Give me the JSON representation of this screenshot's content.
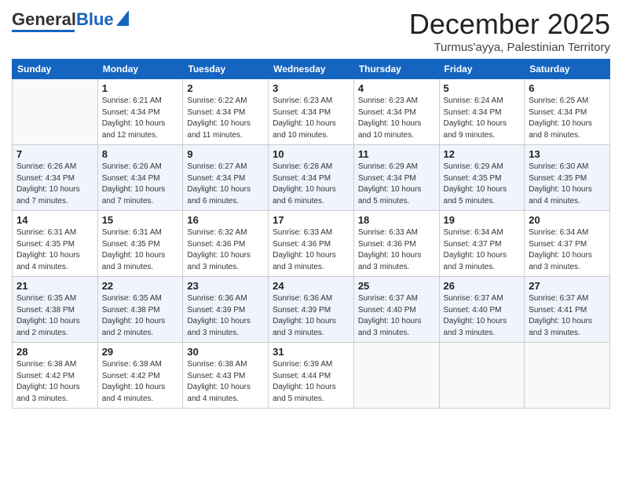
{
  "logo": {
    "general": "General",
    "blue": "Blue"
  },
  "header": {
    "month": "December 2025",
    "location": "Turmus'ayya, Palestinian Territory"
  },
  "weekdays": [
    "Sunday",
    "Monday",
    "Tuesday",
    "Wednesday",
    "Thursday",
    "Friday",
    "Saturday"
  ],
  "weeks": [
    [
      {
        "day": "",
        "sunrise": "",
        "sunset": "",
        "daylight": ""
      },
      {
        "day": "1",
        "sunrise": "Sunrise: 6:21 AM",
        "sunset": "Sunset: 4:34 PM",
        "daylight": "Daylight: 10 hours and 12 minutes."
      },
      {
        "day": "2",
        "sunrise": "Sunrise: 6:22 AM",
        "sunset": "Sunset: 4:34 PM",
        "daylight": "Daylight: 10 hours and 11 minutes."
      },
      {
        "day": "3",
        "sunrise": "Sunrise: 6:23 AM",
        "sunset": "Sunset: 4:34 PM",
        "daylight": "Daylight: 10 hours and 10 minutes."
      },
      {
        "day": "4",
        "sunrise": "Sunrise: 6:23 AM",
        "sunset": "Sunset: 4:34 PM",
        "daylight": "Daylight: 10 hours and 10 minutes."
      },
      {
        "day": "5",
        "sunrise": "Sunrise: 6:24 AM",
        "sunset": "Sunset: 4:34 PM",
        "daylight": "Daylight: 10 hours and 9 minutes."
      },
      {
        "day": "6",
        "sunrise": "Sunrise: 6:25 AM",
        "sunset": "Sunset: 4:34 PM",
        "daylight": "Daylight: 10 hours and 8 minutes."
      }
    ],
    [
      {
        "day": "7",
        "sunrise": "Sunrise: 6:26 AM",
        "sunset": "Sunset: 4:34 PM",
        "daylight": "Daylight: 10 hours and 7 minutes."
      },
      {
        "day": "8",
        "sunrise": "Sunrise: 6:26 AM",
        "sunset": "Sunset: 4:34 PM",
        "daylight": "Daylight: 10 hours and 7 minutes."
      },
      {
        "day": "9",
        "sunrise": "Sunrise: 6:27 AM",
        "sunset": "Sunset: 4:34 PM",
        "daylight": "Daylight: 10 hours and 6 minutes."
      },
      {
        "day": "10",
        "sunrise": "Sunrise: 6:28 AM",
        "sunset": "Sunset: 4:34 PM",
        "daylight": "Daylight: 10 hours and 6 minutes."
      },
      {
        "day": "11",
        "sunrise": "Sunrise: 6:29 AM",
        "sunset": "Sunset: 4:34 PM",
        "daylight": "Daylight: 10 hours and 5 minutes."
      },
      {
        "day": "12",
        "sunrise": "Sunrise: 6:29 AM",
        "sunset": "Sunset: 4:35 PM",
        "daylight": "Daylight: 10 hours and 5 minutes."
      },
      {
        "day": "13",
        "sunrise": "Sunrise: 6:30 AM",
        "sunset": "Sunset: 4:35 PM",
        "daylight": "Daylight: 10 hours and 4 minutes."
      }
    ],
    [
      {
        "day": "14",
        "sunrise": "Sunrise: 6:31 AM",
        "sunset": "Sunset: 4:35 PM",
        "daylight": "Daylight: 10 hours and 4 minutes."
      },
      {
        "day": "15",
        "sunrise": "Sunrise: 6:31 AM",
        "sunset": "Sunset: 4:35 PM",
        "daylight": "Daylight: 10 hours and 3 minutes."
      },
      {
        "day": "16",
        "sunrise": "Sunrise: 6:32 AM",
        "sunset": "Sunset: 4:36 PM",
        "daylight": "Daylight: 10 hours and 3 minutes."
      },
      {
        "day": "17",
        "sunrise": "Sunrise: 6:33 AM",
        "sunset": "Sunset: 4:36 PM",
        "daylight": "Daylight: 10 hours and 3 minutes."
      },
      {
        "day": "18",
        "sunrise": "Sunrise: 6:33 AM",
        "sunset": "Sunset: 4:36 PM",
        "daylight": "Daylight: 10 hours and 3 minutes."
      },
      {
        "day": "19",
        "sunrise": "Sunrise: 6:34 AM",
        "sunset": "Sunset: 4:37 PM",
        "daylight": "Daylight: 10 hours and 3 minutes."
      },
      {
        "day": "20",
        "sunrise": "Sunrise: 6:34 AM",
        "sunset": "Sunset: 4:37 PM",
        "daylight": "Daylight: 10 hours and 3 minutes."
      }
    ],
    [
      {
        "day": "21",
        "sunrise": "Sunrise: 6:35 AM",
        "sunset": "Sunset: 4:38 PM",
        "daylight": "Daylight: 10 hours and 2 minutes."
      },
      {
        "day": "22",
        "sunrise": "Sunrise: 6:35 AM",
        "sunset": "Sunset: 4:38 PM",
        "daylight": "Daylight: 10 hours and 2 minutes."
      },
      {
        "day": "23",
        "sunrise": "Sunrise: 6:36 AM",
        "sunset": "Sunset: 4:39 PM",
        "daylight": "Daylight: 10 hours and 3 minutes."
      },
      {
        "day": "24",
        "sunrise": "Sunrise: 6:36 AM",
        "sunset": "Sunset: 4:39 PM",
        "daylight": "Daylight: 10 hours and 3 minutes."
      },
      {
        "day": "25",
        "sunrise": "Sunrise: 6:37 AM",
        "sunset": "Sunset: 4:40 PM",
        "daylight": "Daylight: 10 hours and 3 minutes."
      },
      {
        "day": "26",
        "sunrise": "Sunrise: 6:37 AM",
        "sunset": "Sunset: 4:40 PM",
        "daylight": "Daylight: 10 hours and 3 minutes."
      },
      {
        "day": "27",
        "sunrise": "Sunrise: 6:37 AM",
        "sunset": "Sunset: 4:41 PM",
        "daylight": "Daylight: 10 hours and 3 minutes."
      }
    ],
    [
      {
        "day": "28",
        "sunrise": "Sunrise: 6:38 AM",
        "sunset": "Sunset: 4:42 PM",
        "daylight": "Daylight: 10 hours and 3 minutes."
      },
      {
        "day": "29",
        "sunrise": "Sunrise: 6:38 AM",
        "sunset": "Sunset: 4:42 PM",
        "daylight": "Daylight: 10 hours and 4 minutes."
      },
      {
        "day": "30",
        "sunrise": "Sunrise: 6:38 AM",
        "sunset": "Sunset: 4:43 PM",
        "daylight": "Daylight: 10 hours and 4 minutes."
      },
      {
        "day": "31",
        "sunrise": "Sunrise: 6:39 AM",
        "sunset": "Sunset: 4:44 PM",
        "daylight": "Daylight: 10 hours and 5 minutes."
      },
      {
        "day": "",
        "sunrise": "",
        "sunset": "",
        "daylight": ""
      },
      {
        "day": "",
        "sunrise": "",
        "sunset": "",
        "daylight": ""
      },
      {
        "day": "",
        "sunrise": "",
        "sunset": "",
        "daylight": ""
      }
    ]
  ]
}
